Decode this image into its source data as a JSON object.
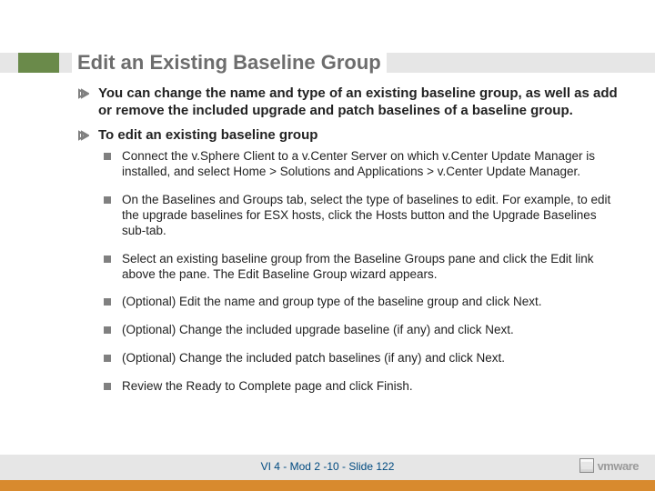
{
  "title": "Edit an Existing Baseline Group",
  "bullets": [
    {
      "text": "You can change the name and type of an existing baseline group, as well as add or remove the included upgrade and patch baselines of a baseline group.",
      "sub": []
    },
    {
      "text": "To edit an existing baseline group",
      "sub": [
        "Connect the v.Sphere Client to a v.Center Server on which v.Center Update Manager is installed, and select Home > Solutions and Applications > v.Center Update Manager.",
        "On the Baselines and Groups tab, select the type of baselines to edit. For example, to edit the upgrade baselines for ESX hosts, click the Hosts button and the Upgrade Baselines sub-tab.",
        "Select an existing baseline group from the Baseline Groups pane and click the Edit link above the pane. The Edit Baseline Group wizard appears.",
        "(Optional) Edit the name and group type of the baseline group and click Next.",
        "(Optional) Change the included upgrade baseline (if any) and click Next.",
        "(Optional) Change the included patch baselines (if any) and click Next.",
        "Review the Ready to Complete page and click Finish."
      ]
    }
  ],
  "footer": {
    "slideinfo": "VI 4 - Mod 2 -10 - Slide 122",
    "logo": "vmware"
  }
}
